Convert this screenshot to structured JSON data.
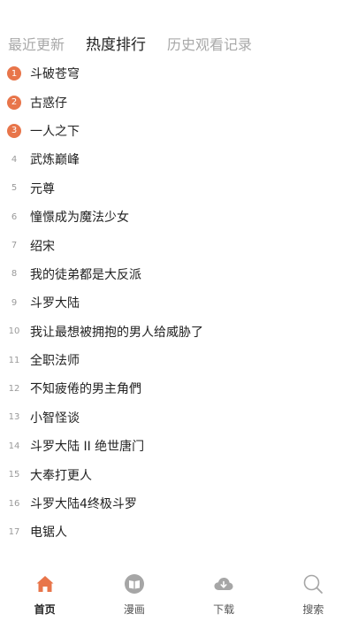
{
  "tabs": [
    {
      "label": "最近更新",
      "active": false
    },
    {
      "label": "热度排行",
      "active": true
    },
    {
      "label": "历史观看记录",
      "active": false
    }
  ],
  "ranking": [
    {
      "rank": "1",
      "title": "斗破苍穹"
    },
    {
      "rank": "2",
      "title": "古惑仔"
    },
    {
      "rank": "3",
      "title": "一人之下"
    },
    {
      "rank": "4",
      "title": "武炼巅峰"
    },
    {
      "rank": "5",
      "title": "元尊"
    },
    {
      "rank": "6",
      "title": "憧憬成为魔法少女"
    },
    {
      "rank": "7",
      "title": "绍宋"
    },
    {
      "rank": "8",
      "title": "我的徒弟都是大反派"
    },
    {
      "rank": "9",
      "title": "斗罗大陆"
    },
    {
      "rank": "10",
      "title": "我让最想被拥抱的男人给威胁了"
    },
    {
      "rank": "11",
      "title": "全职法师"
    },
    {
      "rank": "12",
      "title": "不知疲倦的男主角們"
    },
    {
      "rank": "13",
      "title": "小智怪谈"
    },
    {
      "rank": "14",
      "title": "斗罗大陆 II 绝世唐门"
    },
    {
      "rank": "15",
      "title": "大奉打更人"
    },
    {
      "rank": "16",
      "title": "斗罗大陆4终极斗罗"
    },
    {
      "rank": "17",
      "title": "电锯人"
    }
  ],
  "nav": [
    {
      "label": "首页",
      "icon": "home-icon",
      "active": true
    },
    {
      "label": "漫画",
      "icon": "comic-book-icon",
      "active": false
    },
    {
      "label": "下载",
      "icon": "cloud-download-icon",
      "active": false
    },
    {
      "label": "搜索",
      "icon": "search-icon",
      "active": false
    }
  ],
  "colors": {
    "accent": "#e8754a",
    "icon_gray": "#a6a6a6"
  }
}
